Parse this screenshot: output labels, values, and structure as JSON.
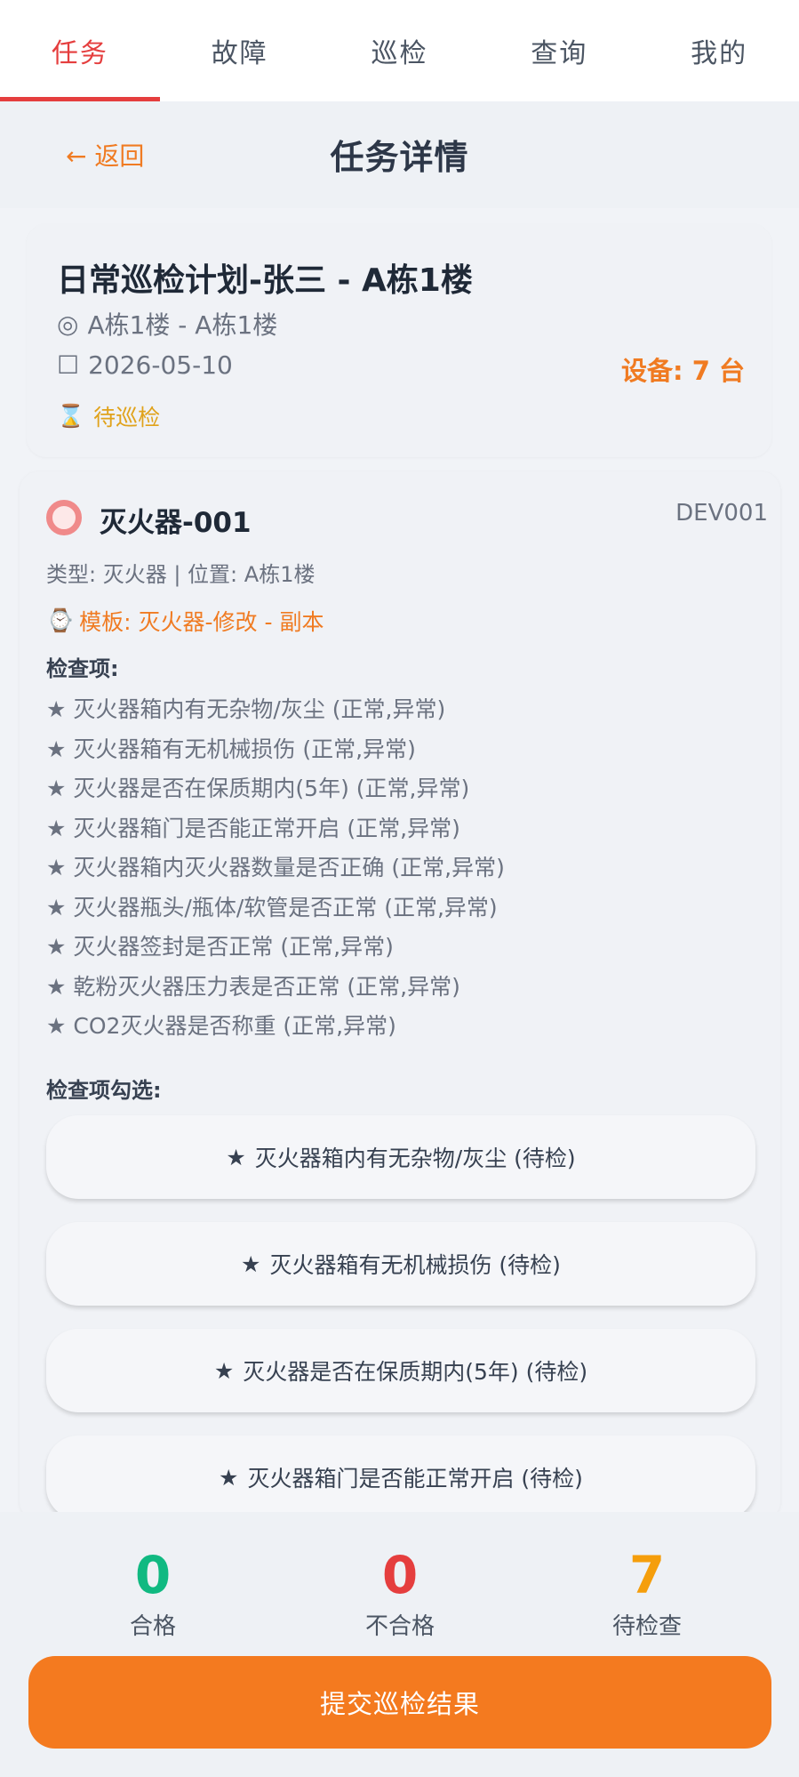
{
  "tabs": [
    {
      "label": "任务",
      "active": true
    },
    {
      "label": "故障",
      "active": false
    },
    {
      "label": "巡检",
      "active": false
    },
    {
      "label": "查询",
      "active": false
    },
    {
      "label": "我的",
      "active": false
    }
  ],
  "header": {
    "back_label": "← 返回",
    "title": "任务详情"
  },
  "task": {
    "title": "日常巡检计划-张三 - A栋1楼",
    "location_icon": "◎",
    "location": "A栋1楼 - A栋1楼",
    "date_icon": "☐",
    "date": "2026-05-10",
    "device_count": "设备: 7 台",
    "status_icon": "⌛",
    "status": "待巡检"
  },
  "device": {
    "name": "灭火器-001",
    "code": "DEV001",
    "meta": "类型: 灭火器 | 位置: A栋1楼",
    "template_icon": "⌚",
    "template": "模板: 灭火器-修改 - 副本",
    "check_items_label": "检查项:",
    "check_items": [
      "灭火器箱内有无杂物/灰尘 (正常,异常)",
      "灭火器箱有无机械损伤 (正常,异常)",
      "灭火器是否在保质期内(5年) (正常,异常)",
      "灭火器箱门是否能正常开启 (正常,异常)",
      "灭火器箱内灭火器数量是否正确 (正常,异常)",
      "灭火器瓶头/瓶体/软管是否正常 (正常,异常)",
      "灭火器签封是否正常 (正常,异常)",
      "乾粉灭火器压力表是否正常 (正常,异常)",
      "CO2灭火器是否称重 (正常,异常)"
    ],
    "pick_label": "检查项勾选:",
    "pick_items": [
      "灭火器箱内有无杂物/灰尘 (待检)",
      "灭火器箱有无机械损伤 (待检)",
      "灭火器是否在保质期内(5年) (待检)",
      "灭火器箱门是否能正常开启 (待检)"
    ]
  },
  "summary": {
    "pass_value": "0",
    "pass_label": "合格",
    "fail_value": "0",
    "fail_label": "不合格",
    "pending_value": "7",
    "pending_label": "待检查",
    "submit_label": "提交巡检结果"
  },
  "colors": {
    "accent": "#f47a1f",
    "active_tab": "#e53e3e",
    "pass": "#10b981",
    "fail": "#e53e3e",
    "pending": "#f59e0b"
  }
}
